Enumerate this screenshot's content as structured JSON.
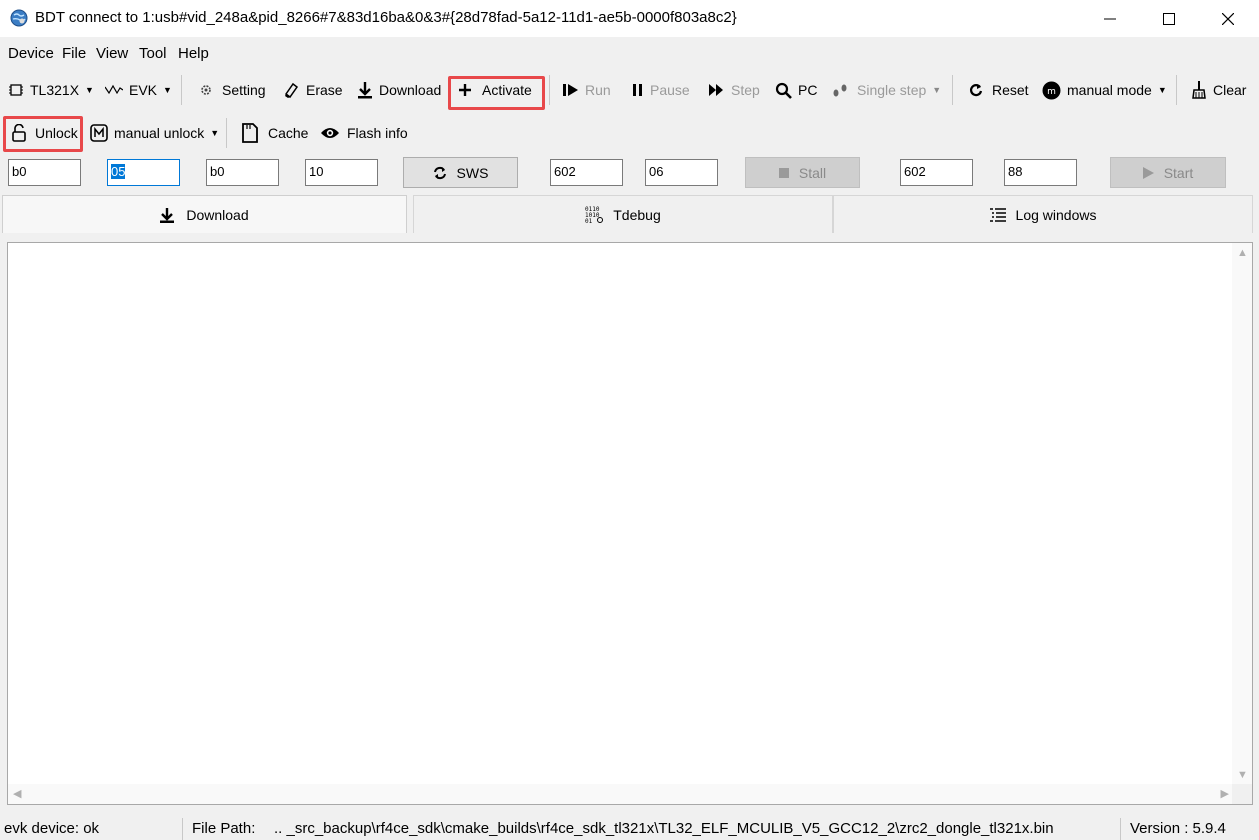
{
  "window": {
    "title": "BDT connect to 1:usb#vid_248a&pid_8266#7&83d16ba&0&3#{28d78fad-5a12-11d1-ae5b-0000f803a8c2}"
  },
  "menu": [
    "Device",
    "File",
    "View",
    "Tool",
    "Help"
  ],
  "toolbar1": {
    "chip": "TL321X",
    "board": "EVK",
    "setting": "Setting",
    "erase": "Erase",
    "download": "Download",
    "activate": "Activate",
    "run": "Run",
    "pause": "Pause",
    "step": "Step",
    "pc": "PC",
    "single_step": "Single step",
    "reset": "Reset",
    "mode": "manual mode",
    "clear": "Clear"
  },
  "toolbar2": {
    "unlock": "Unlock",
    "manual_unlock": "manual unlock",
    "cache": "Cache",
    "flash_info": "Flash info"
  },
  "fields": {
    "f1": "b0",
    "f2": "05",
    "f3": "b0",
    "f4": "10",
    "sws": "SWS",
    "f5": "602",
    "f6": "06",
    "stall": "Stall",
    "f7": "602",
    "f8": "88",
    "start": "Start"
  },
  "tabs": {
    "download": "Download",
    "tdebug": "Tdebug",
    "log": "Log windows"
  },
  "status": {
    "device": "evk device: ok",
    "file_path_label": "File Path:",
    "file_path": "..  _src_backup\\rf4ce_sdk\\cmake_builds\\rf4ce_sdk_tl321x\\TL32_ELF_MCULIB_V5_GCC12_2\\zrc2_dongle_tl321x.bin",
    "version": "Version : 5.9.4"
  },
  "colors": {
    "highlight": "#e8484a",
    "selection": "#0078d7"
  }
}
